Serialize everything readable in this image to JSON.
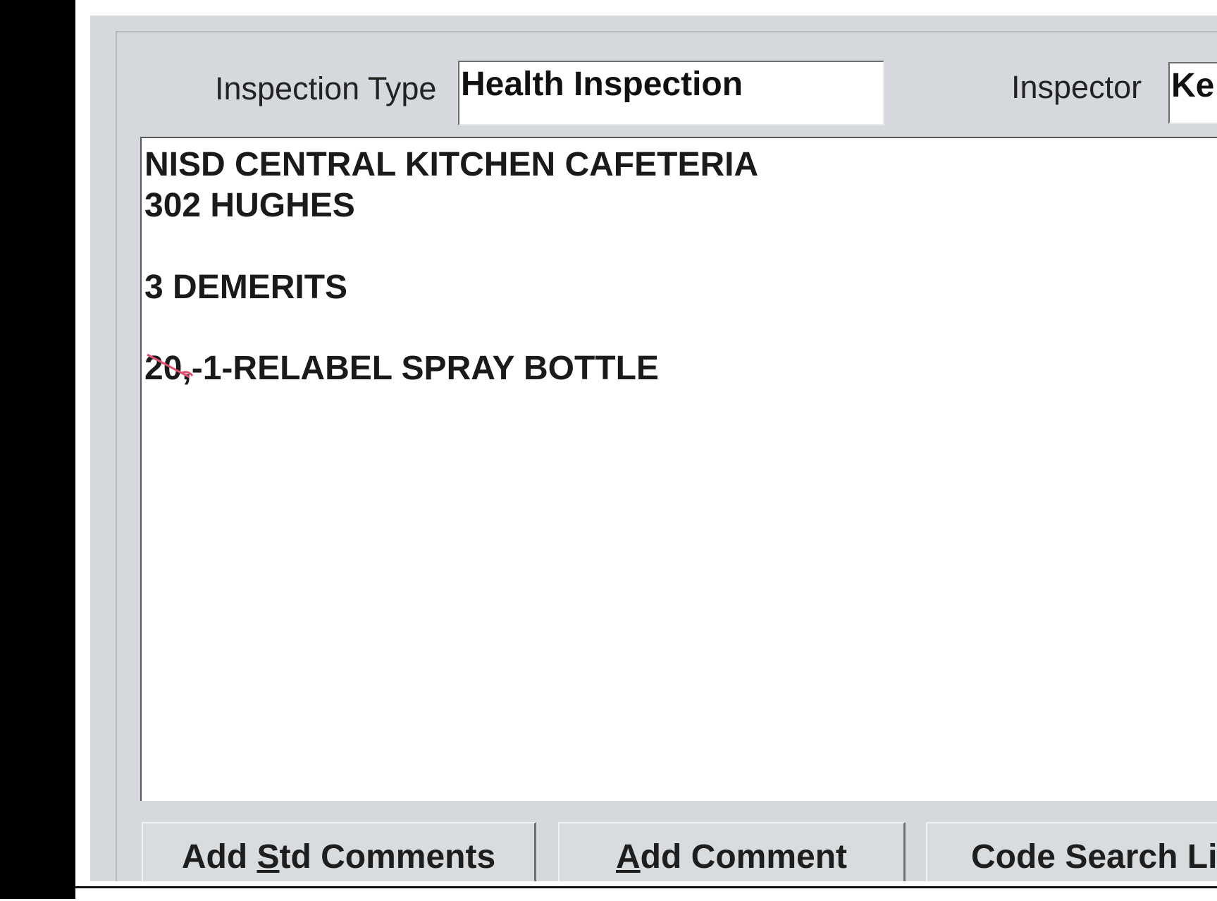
{
  "form": {
    "inspection_type_label": "Inspection Type",
    "inspection_type_value": "Health Inspection",
    "inspector_label": "Inspector",
    "inspector_value": "Ke"
  },
  "comments": {
    "lines": [
      "NISD CENTRAL KITCHEN CAFETERIA",
      "302 HUGHES",
      "3 DEMERITS",
      "-1-RELABEL SPRAY BOTTLE"
    ],
    "struck_prefix": "20,",
    "pen_color": "#e0506e"
  },
  "buttons": {
    "add_std_comments": {
      "pre": "Add ",
      "accel": "S",
      "post": "td Comments"
    },
    "add_comment": {
      "pre": "",
      "accel": "A",
      "post": "dd Comment"
    },
    "code_search": {
      "label": "Code Search Li"
    }
  }
}
